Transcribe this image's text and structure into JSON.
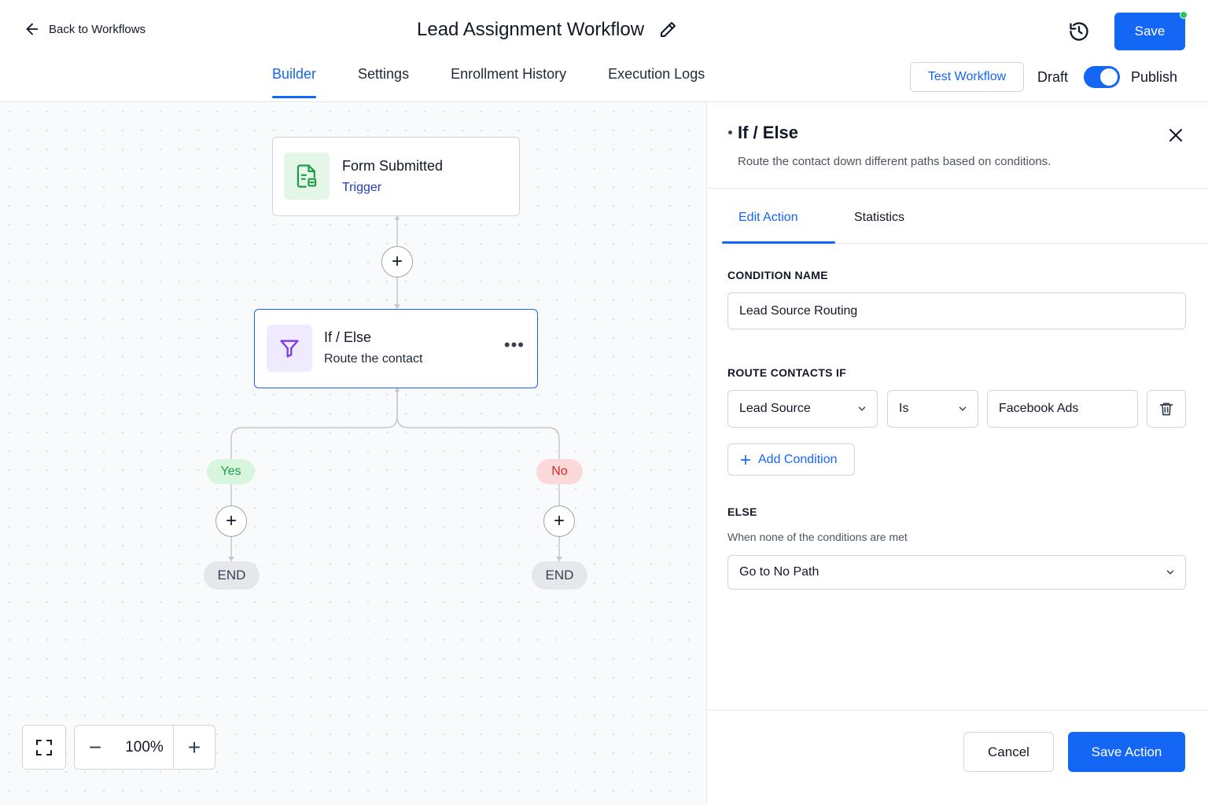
{
  "header": {
    "back_label": "Back to Workflows",
    "title": "Lead Assignment Workflow",
    "save_label": "Save",
    "test_label": "Test Workflow",
    "draft_label": "Draft",
    "publish_label": "Publish",
    "publish_toggle_on": true,
    "tabs": [
      {
        "label": "Builder",
        "active": true
      },
      {
        "label": "Settings",
        "active": false
      },
      {
        "label": "Enrollment History",
        "active": false
      },
      {
        "label": "Execution Logs",
        "active": false
      }
    ]
  },
  "canvas": {
    "trigger": {
      "title": "Form Submitted",
      "subtitle": "Trigger",
      "icon": "form-document-icon"
    },
    "ifelse": {
      "title": "If / Else",
      "subtitle": "Route the contact",
      "icon": "funnel-icon",
      "more": "•••"
    },
    "branches": {
      "yes": {
        "label": "Yes",
        "end": "END"
      },
      "no": {
        "label": "No",
        "end": "END"
      }
    },
    "zoom": "100%"
  },
  "panel": {
    "title": "If / Else",
    "description": "Route the contact down different paths based on conditions.",
    "tabs": [
      {
        "label": "Edit Action",
        "active": true
      },
      {
        "label": "Statistics",
        "active": false
      }
    ],
    "condition_name_label": "CONDITION NAME",
    "condition_name_value": "Lead Source Routing",
    "route_label": "ROUTE CONTACTS IF",
    "condition": {
      "field": "Lead Source",
      "operator": "Is",
      "value": "Facebook Ads"
    },
    "add_condition_label": "Add Condition",
    "else_label": "ELSE",
    "else_desc": "When none of the conditions are met",
    "else_value": "Go to No Path",
    "cancel_label": "Cancel",
    "save_action_label": "Save Action"
  },
  "colors": {
    "accent": "#1466f5",
    "yes_bg": "#d8f5dd",
    "yes_text": "#1f9d45",
    "no_bg": "#fcd9d9",
    "no_text": "#dc2626",
    "status_dot": "#22c55e"
  }
}
